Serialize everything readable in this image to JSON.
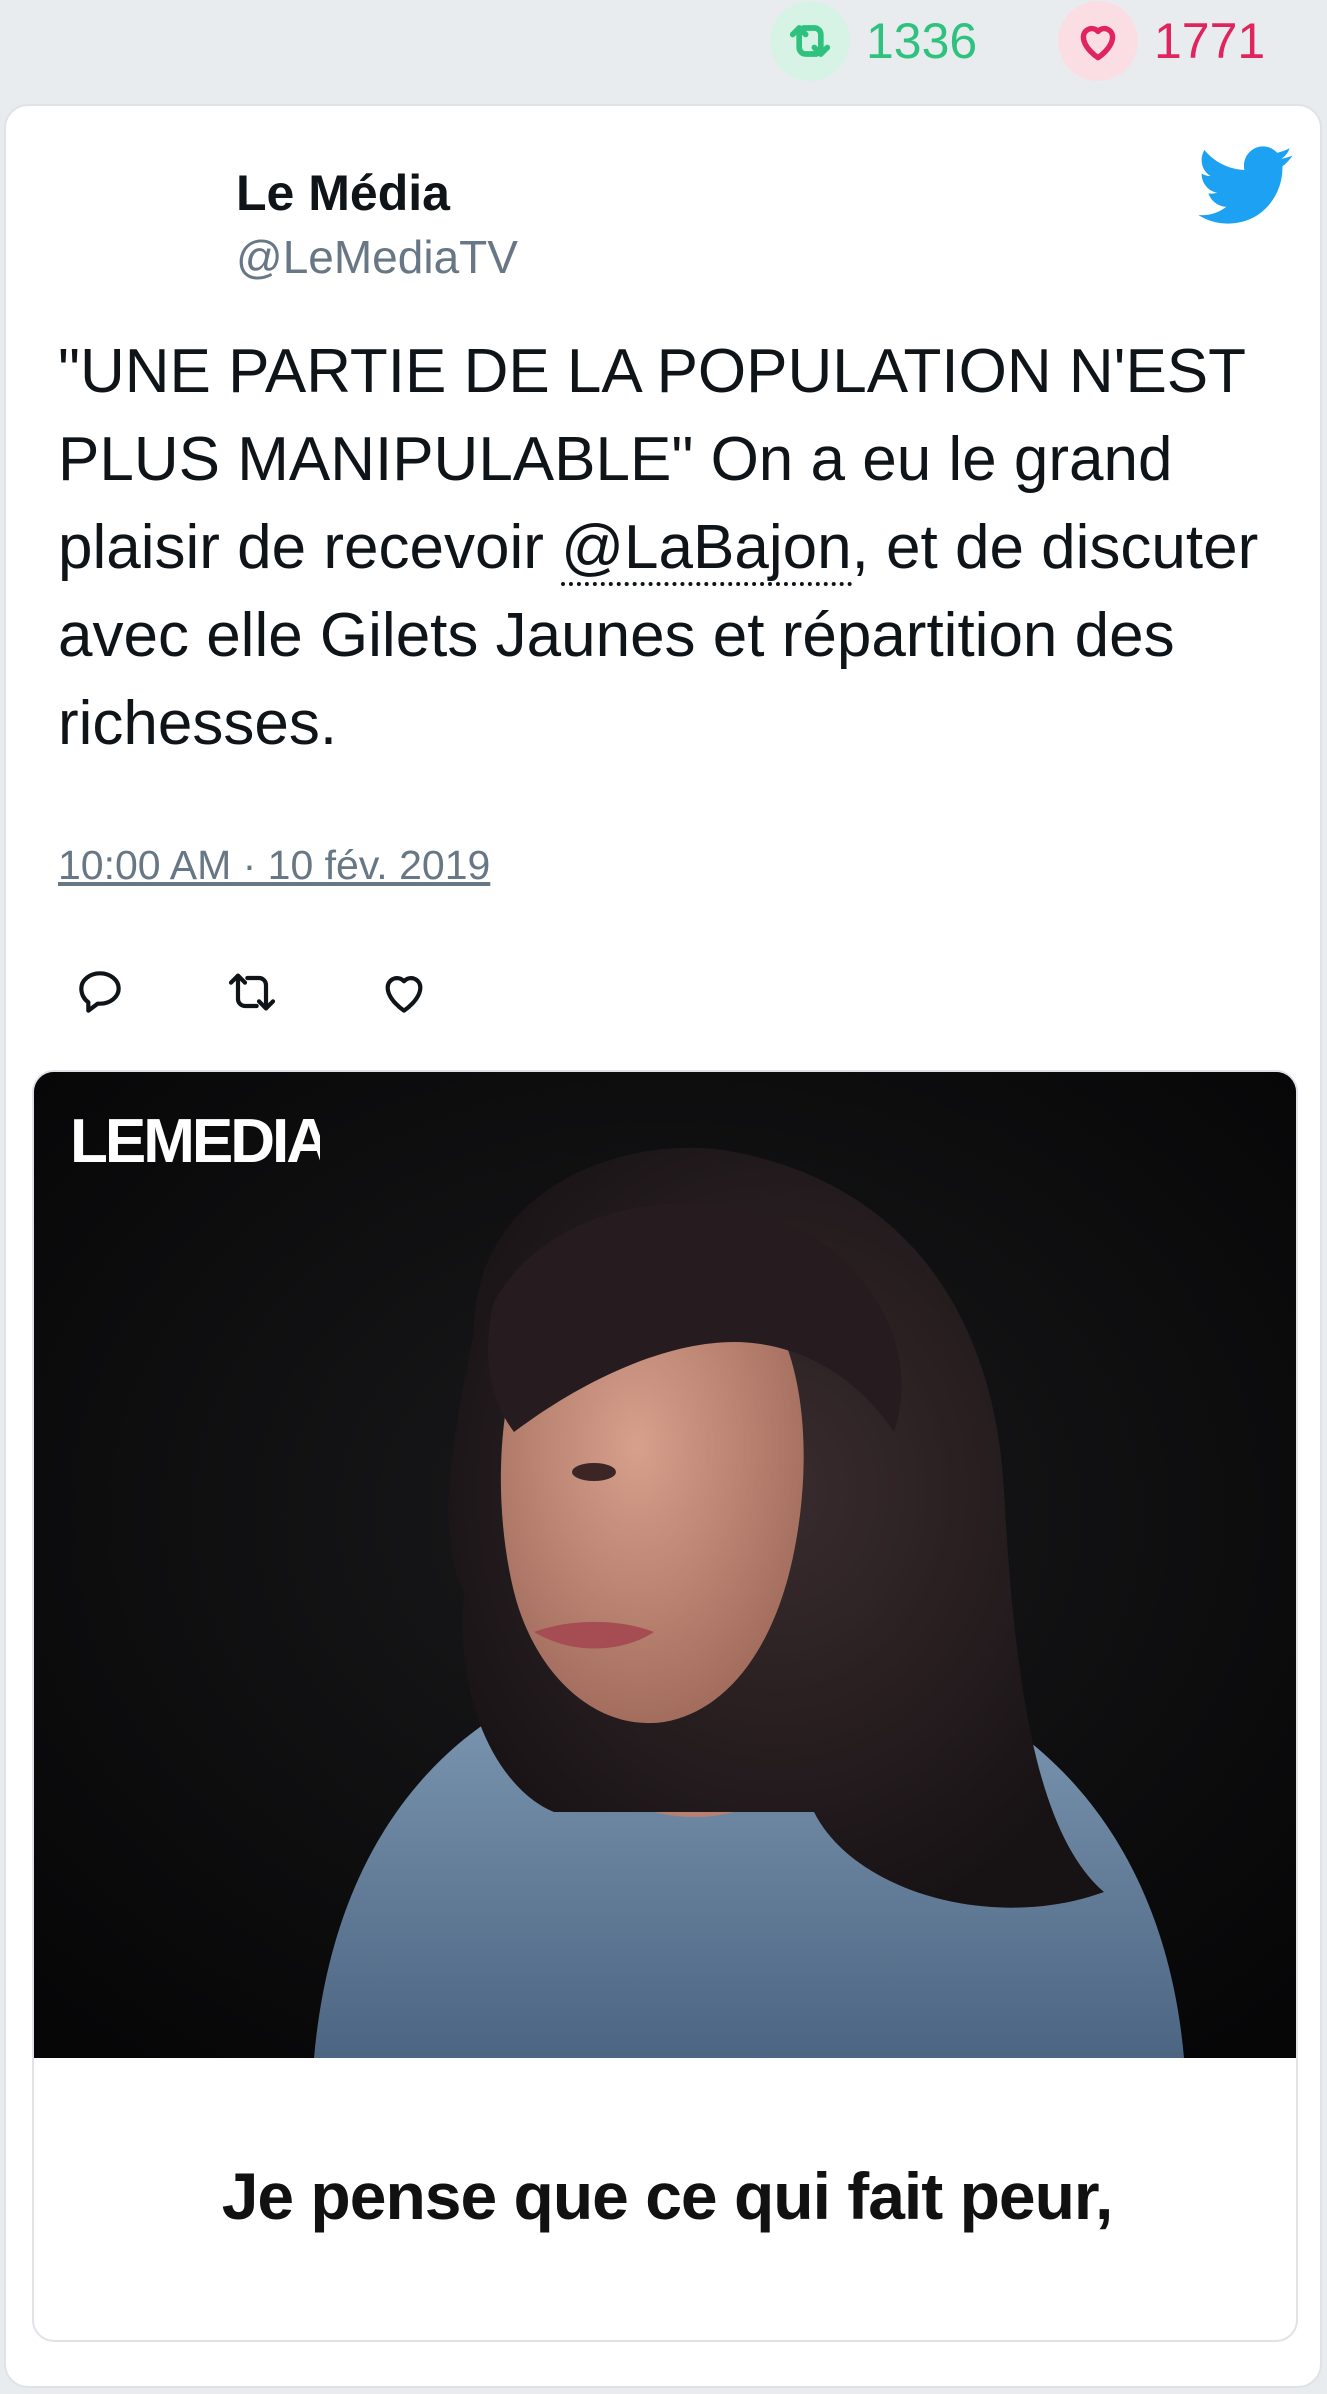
{
  "stats": {
    "retweets": "1336",
    "likes": "1771",
    "retweet_color": "#2ec27e",
    "like_color": "#e0245e"
  },
  "tweet": {
    "author_name": "Le Média",
    "author_handle": "@LeMediaTV",
    "text_before": "\"UNE PARTIE DE LA POPULATION N'EST PLUS MANIPULABLE\" On a eu le grand plaisir de recevoir ",
    "mention": "@LaBajon",
    "text_after": ", et de discuter avec elle Gilets Jaunes et répartition des richesses.",
    "timestamp": "10:00 AM · 10 fév. 2019"
  },
  "icons": {
    "brand": "twitter-bird-icon",
    "actions": [
      "reply-icon",
      "retweet-icon",
      "like-icon"
    ]
  },
  "media": {
    "logo_text": "LEMEDIA",
    "caption": "Je pense que ce qui fait peur,"
  },
  "colors": {
    "twitter_blue": "#1da1f2",
    "background": "#e9ecef"
  }
}
